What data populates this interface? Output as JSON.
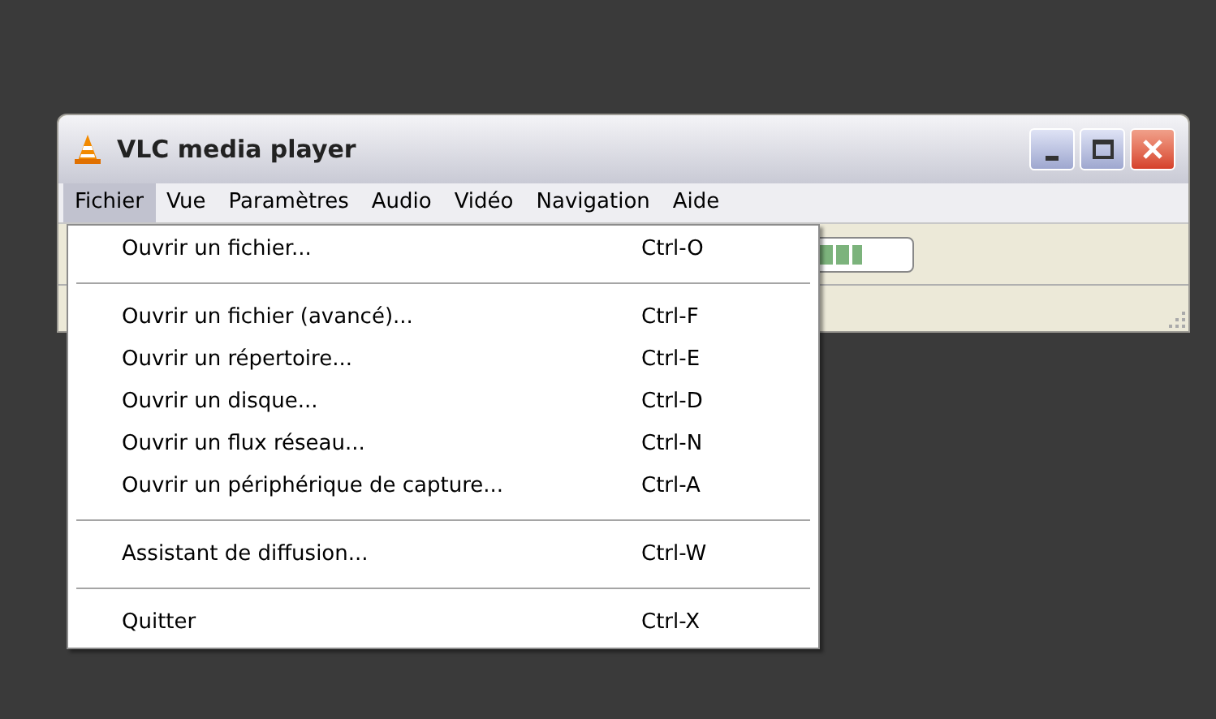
{
  "window": {
    "title": "VLC media player"
  },
  "menu_bar": [
    {
      "label": "Fichier",
      "selected": true
    },
    {
      "label": "Vue",
      "selected": false
    },
    {
      "label": "Paramètres",
      "selected": false
    },
    {
      "label": "Audio",
      "selected": false
    },
    {
      "label": "Vidéo",
      "selected": false
    },
    {
      "label": "Navigation",
      "selected": false
    },
    {
      "label": "Aide",
      "selected": false
    }
  ],
  "volume": {
    "level": 0.7
  },
  "menu": [
    {
      "kind": "item",
      "label": "Ouvrir un fichier...",
      "shortcut": "Ctrl-O"
    },
    {
      "kind": "separator"
    },
    {
      "kind": "item",
      "label": "Ouvrir un fichier (avancé)...",
      "shortcut": "Ctrl-F"
    },
    {
      "kind": "item",
      "label": "Ouvrir un répertoire...",
      "shortcut": "Ctrl-E"
    },
    {
      "kind": "item",
      "label": "Ouvrir un disque...",
      "shortcut": "Ctrl-D"
    },
    {
      "kind": "item",
      "label": "Ouvrir un flux réseau...",
      "shortcut": "Ctrl-N"
    },
    {
      "kind": "item",
      "label": "Ouvrir un périphérique de capture...",
      "shortcut": "Ctrl-A"
    },
    {
      "kind": "separator"
    },
    {
      "kind": "item",
      "label": "Assistant de diffusion...",
      "shortcut": "Ctrl-W"
    },
    {
      "kind": "separator"
    },
    {
      "kind": "item",
      "label": "Quitter",
      "shortcut": "Ctrl-X"
    }
  ]
}
